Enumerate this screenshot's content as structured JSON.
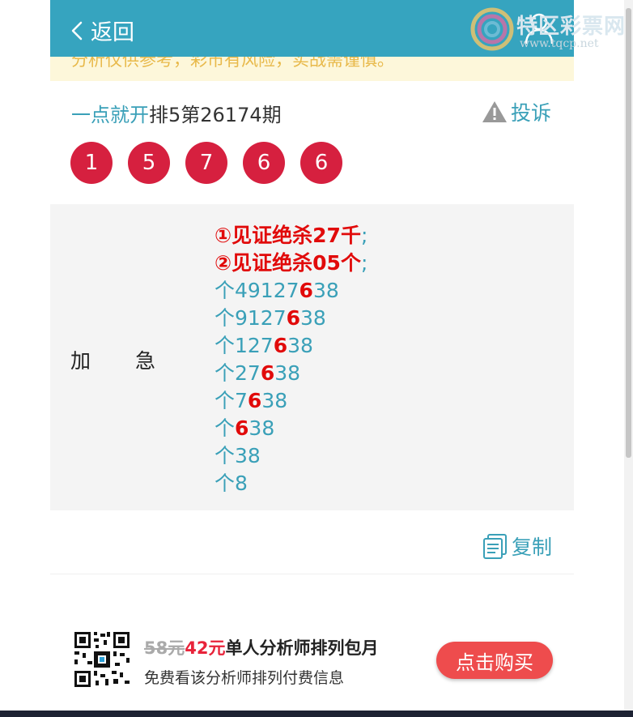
{
  "nav": {
    "back_label": "返回"
  },
  "watermark": {
    "title": "特区彩票网",
    "url": "www.tqcp.net"
  },
  "notice": {
    "text": "分析仅供参考，彩市有风险，实战需谨慎。"
  },
  "header": {
    "link_text": "一点就开",
    "issue_text": "排5第26174期",
    "complain_label": "投诉"
  },
  "balls": [
    "1",
    "5",
    "7",
    "6",
    "6"
  ],
  "content": {
    "label_left": "加",
    "label_right": "急",
    "lines": [
      {
        "pre": "①见证绝杀27千",
        "hl": "",
        "post": "",
        "sep": ";",
        "strong": true
      },
      {
        "pre": "②见证绝杀05个",
        "hl": "",
        "post": "",
        "sep": ";",
        "strong": true
      },
      {
        "pre": "个49127",
        "hl": "6",
        "post": "38"
      },
      {
        "pre": "个9127",
        "hl": "6",
        "post": "38"
      },
      {
        "pre": "个127",
        "hl": "6",
        "post": "38"
      },
      {
        "pre": "个27",
        "hl": "6",
        "post": "38"
      },
      {
        "pre": "个7",
        "hl": "6",
        "post": "38"
      },
      {
        "pre": "个",
        "hl": "6",
        "post": "38"
      },
      {
        "pre": "个38",
        "hl": "",
        "post": ""
      },
      {
        "pre": "个8",
        "hl": "",
        "post": ""
      }
    ]
  },
  "copy": {
    "label": "复制"
  },
  "promo": {
    "old_price": "58元",
    "new_price": "42元",
    "title_rest": "单人分析师排列包月",
    "subtitle": "免费看该分析师排列付费信息",
    "buy_label": "点击购买"
  },
  "colors": {
    "nav": "#36a4bf",
    "accent": "#3aa0b8",
    "ball": "#d6203f",
    "highlight": "#e10a0a",
    "buy": "#ee4c4d"
  }
}
